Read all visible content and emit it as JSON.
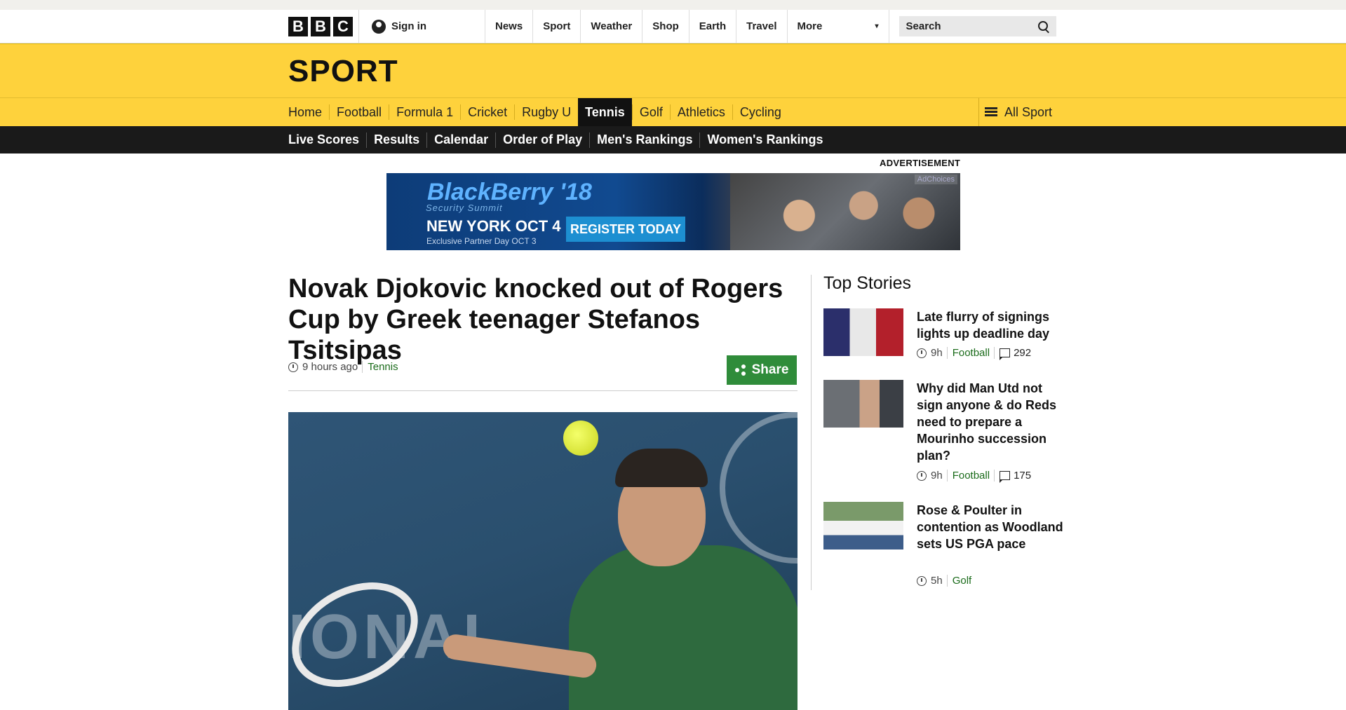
{
  "bbc": {
    "logo_letters": [
      "B",
      "B",
      "C"
    ],
    "signin_label": "Sign in",
    "nav": [
      "News",
      "Sport",
      "Weather",
      "Shop",
      "Earth",
      "Travel"
    ],
    "more_label": "More",
    "search_placeholder": "Search"
  },
  "section": {
    "title": "SPORT"
  },
  "sport_nav": {
    "items": [
      "Home",
      "Football",
      "Formula 1",
      "Cricket",
      "Rugby U",
      "Tennis",
      "Golf",
      "Athletics",
      "Cycling"
    ],
    "active": "Tennis",
    "all_sport_label": "All Sport"
  },
  "sub_nav": {
    "items": [
      "Live Scores",
      "Results",
      "Calendar",
      "Order of Play",
      "Men's Rankings",
      "Women's Rankings"
    ]
  },
  "advert": {
    "label": "ADVERTISEMENT",
    "brand": "BlackBerry '18",
    "tagline": "Security Summit",
    "city_date": "NEW YORK OCT 4",
    "partner_day": "Exclusive Partner Day OCT 3",
    "cta": "REGISTER TODAY",
    "adchoices": "AdChoices"
  },
  "article": {
    "headline": "Novak Djokovic knocked out of Rogers Cup by Greek teenager Stefanos Tsitsipas",
    "time": "9 hours ago",
    "tag": "Tennis",
    "share_label": "Share",
    "hero_text": "IONAL"
  },
  "top_stories": {
    "title": "Top Stories",
    "items": [
      {
        "title": "Late flurry of signings lights up deadline day",
        "time": "9h",
        "tag": "Football",
        "comments": "292"
      },
      {
        "title": "Why did Man Utd not sign anyone & do Reds need to prepare a Mourinho succession plan?",
        "time": "9h",
        "tag": "Football",
        "comments": "175"
      },
      {
        "title": "Rose & Poulter in contention as Woodland sets US PGA pace",
        "time": "5h",
        "tag": "Golf",
        "comments": null
      }
    ]
  },
  "colors": {
    "sport_yellow": "#fed23c",
    "subnav_black": "#1a1a1a",
    "share_green": "#2f8c3a",
    "tag_green": "#1a6b1a"
  }
}
